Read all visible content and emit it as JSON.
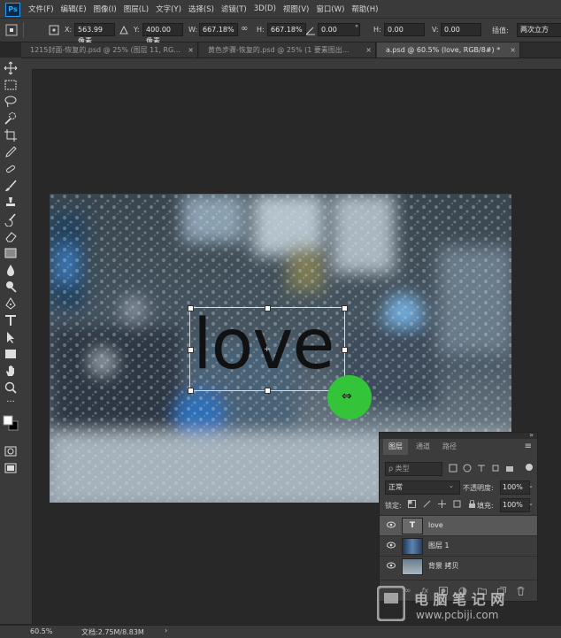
{
  "app": {
    "logo": "Ps"
  },
  "menu": [
    "文件(F)",
    "编辑(E)",
    "图像(I)",
    "图层(L)",
    "文字(Y)",
    "选择(S)",
    "滤镜(T)",
    "3D(D)",
    "视图(V)",
    "窗口(W)",
    "帮助(H)"
  ],
  "options": {
    "x_label": "X:",
    "x_value": "563.99 像素",
    "y_label": "Y:",
    "y_value": "400.00 像素",
    "w_label": "W:",
    "w_value": "667.18%",
    "h_label": "H:",
    "h_value": "667.18%",
    "angle_value": "0.00",
    "hskew_label": "H:",
    "hskew_value": "0.00",
    "vskew_label": "V:",
    "vskew_value": "0.00",
    "interp_label": "插值:",
    "interp_value": "两次立方"
  },
  "tabs": [
    {
      "label": "1215封面-恢复的.psd @ 25% (图层 11, RG..."
    },
    {
      "label": "黄色步骤-恢复的.psd @ 25% (1 要素图出..."
    },
    {
      "label": "a.psd @ 60.5% (love, RGB/8#) *"
    }
  ],
  "canvas": {
    "text": "love"
  },
  "layers_panel": {
    "tabs": [
      "图层",
      "通道",
      "路径"
    ],
    "filter_label": "ρ 类型",
    "blend_mode": "正常",
    "opacity_label": "不透明度:",
    "opacity_value": "100%",
    "lock_label": "锁定:",
    "fill_label": "填充:",
    "fill_value": "100%",
    "layers": [
      {
        "name": "love",
        "type_glyph": "T"
      },
      {
        "name": "图层 1"
      },
      {
        "name": "背景 拷贝"
      }
    ],
    "footer_icons": [
      "link-icon",
      "fx-icon",
      "mask-icon",
      "adjustment-icon",
      "group-icon",
      "new-layer-icon",
      "trash-icon"
    ]
  },
  "status": {
    "zoom": "60.5%",
    "doc_info": "文档:2.75M/8.83M"
  },
  "watermark": {
    "line1": "电 脑 笔 记 网",
    "line2": "www.pcbiji.com"
  },
  "colors": {
    "accent": "#2fa8ff",
    "cursor_green": "#33c43a"
  }
}
